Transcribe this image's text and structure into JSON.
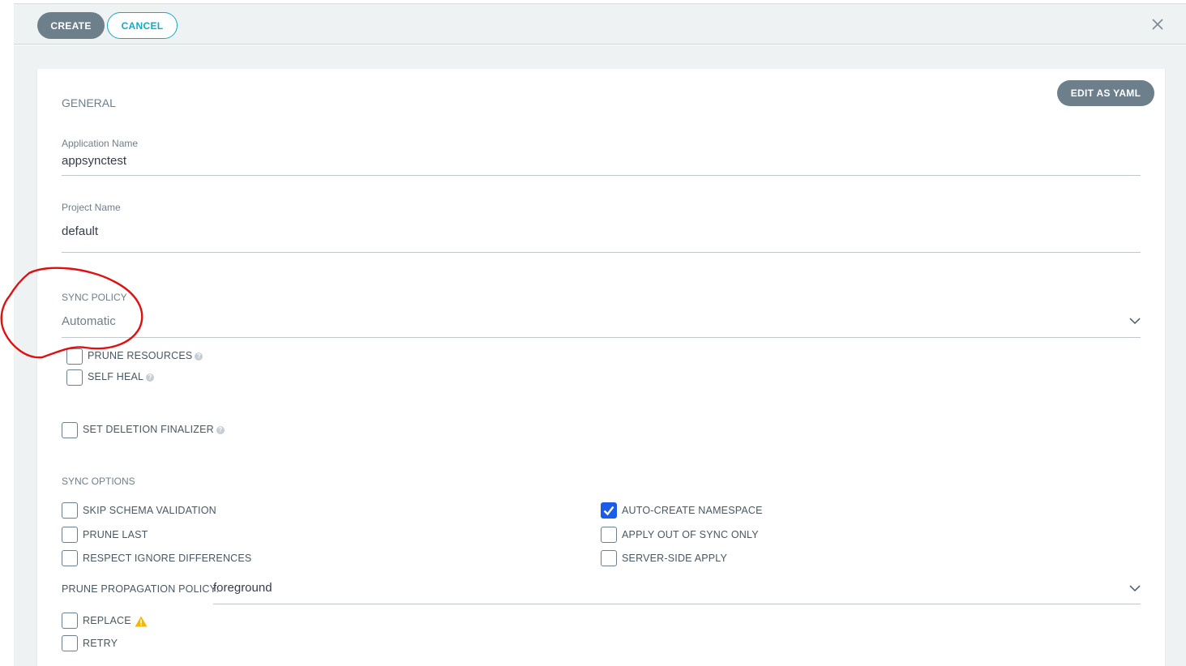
{
  "toolbar": {
    "create_label": "CREATE",
    "cancel_label": "CANCEL",
    "close_icon": "close-icon"
  },
  "panel": {
    "edit_yaml_label": "EDIT AS YAML",
    "general_title": "GENERAL",
    "application_name": {
      "label": "Application Name",
      "value": "appsynctest"
    },
    "project_name": {
      "label": "Project Name",
      "value": "default"
    },
    "sync_policy": {
      "label": "SYNC POLICY",
      "value": "Automatic",
      "options": [
        {
          "label": "PRUNE RESOURCES",
          "checked": false
        },
        {
          "label": "SELF HEAL",
          "checked": false
        }
      ]
    },
    "deletion_finalizer": {
      "label": "SET DELETION FINALIZER",
      "checked": false
    },
    "sync_options": {
      "title": "SYNC OPTIONS",
      "left": [
        {
          "label": "SKIP SCHEMA VALIDATION",
          "checked": false
        },
        {
          "label": "PRUNE LAST",
          "checked": false
        },
        {
          "label": "RESPECT IGNORE DIFFERENCES",
          "checked": false
        }
      ],
      "right": [
        {
          "label": "AUTO-CREATE NAMESPACE",
          "checked": true
        },
        {
          "label": "APPLY OUT OF SYNC ONLY",
          "checked": false
        },
        {
          "label": "SERVER-SIDE APPLY",
          "checked": false
        }
      ]
    },
    "prune_propagation": {
      "label": "PRUNE PROPAGATION POLICY:",
      "value": "foreground"
    },
    "replace": {
      "label": "REPLACE",
      "checked": false
    },
    "retry": {
      "label": "RETRY",
      "checked": false
    }
  },
  "colors": {
    "accent": "#0dadc3",
    "button_grey": "#6d7f8b",
    "checkbox_checked": "#1c5ce8",
    "annotation_red": "#e01010",
    "warning": "#f5b800"
  }
}
